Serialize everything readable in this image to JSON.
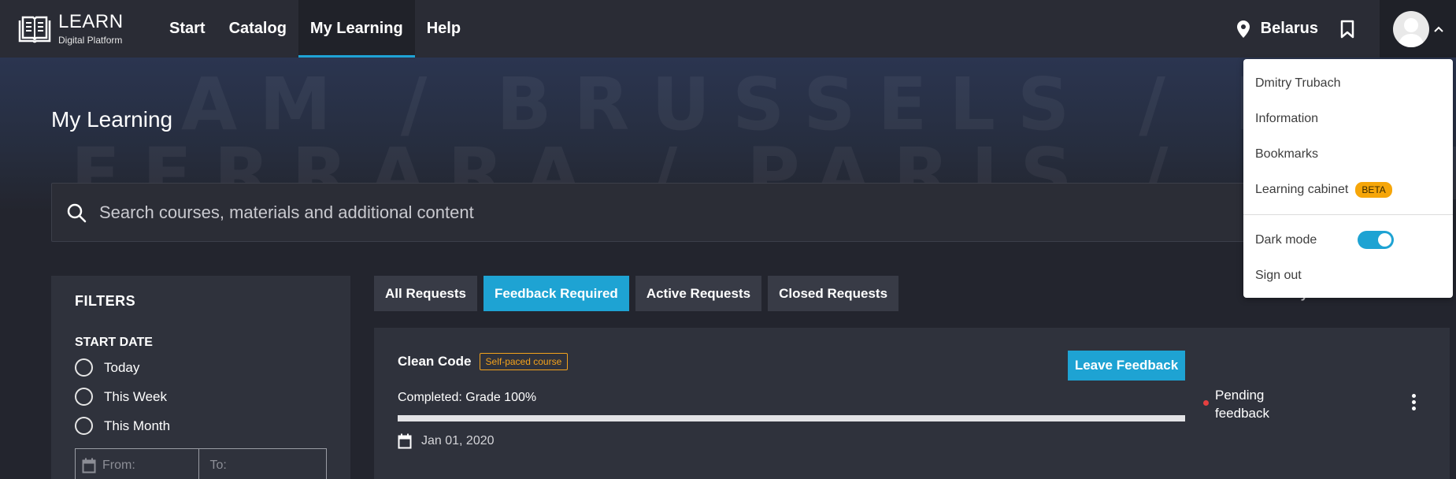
{
  "app": {
    "logo_title": "LEARN",
    "logo_subtitle": "Digital Platform"
  },
  "nav": {
    "items": [
      {
        "label": "Start",
        "active": false
      },
      {
        "label": "Catalog",
        "active": false
      },
      {
        "label": "My Learning",
        "active": true
      },
      {
        "label": "Help",
        "active": false
      }
    ],
    "location": "Belarus",
    "icons": [
      "location-pin-icon",
      "bookmark-icon",
      "avatar-icon",
      "chevron-up-icon"
    ]
  },
  "hero": {
    "background_text_1": "AM / BRUSSELS / DUBLIN / POTSDAM",
    "background_text_2": "FERRARA / PARIS / ROME / OSLO / MADRID",
    "title": "My Learning"
  },
  "search": {
    "placeholder": "Search courses, materials and additional content",
    "value": ""
  },
  "filters": {
    "title": "FILTERS",
    "start_date_title": "START DATE",
    "options": [
      "Today",
      "This Week",
      "This Month"
    ],
    "from_placeholder": "From:",
    "to_placeholder": "To:"
  },
  "tabs": [
    {
      "label": "All Requests",
      "active": false
    },
    {
      "label": "Feedback Required",
      "active": true
    },
    {
      "label": "Active Requests",
      "active": false
    },
    {
      "label": "Closed Requests",
      "active": false
    }
  ],
  "sort": {
    "text": "...ay"
  },
  "course": {
    "title": "Clean Code",
    "badge": "Self-paced course",
    "action_label": "Leave Feedback",
    "grade_text": "Completed: Grade 100%",
    "progress_percent": 100,
    "date": "Jan 01, 2020",
    "status": "Pending feedback",
    "status_color": "#e54040"
  },
  "dropdown": {
    "user_name": "Dmitry Trubach",
    "items": [
      "Information",
      "Bookmarks"
    ],
    "learning_cabinet": "Learning cabinet",
    "beta_badge": "BETA",
    "dark_mode_label": "Dark mode",
    "dark_mode_on": true,
    "sign_out": "Sign out"
  },
  "colors": {
    "accent": "#1ea3d3",
    "background": "#23252e",
    "panel": "#2f323c",
    "badge_orange": "#f3a21c"
  }
}
